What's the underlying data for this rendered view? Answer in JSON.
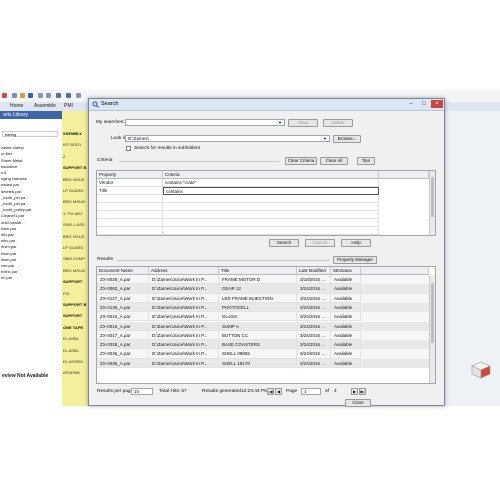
{
  "background_app": {
    "tabs": [
      "Home",
      "Assemble",
      "PMI"
    ],
    "library_title": "arts Library",
    "library_search": "earing",
    "library_items": [
      "",
      "caster clamp",
      "ur liter",
      "Sheet Metal",
      "nsulation",
      "s 8",
      "nging Harness",
      "eaded.par",
      "deleted.par",
      "_tooth_pin.pa...",
      "_tooth_pin.pa...",
      "_tooth_pulley.par",
      "Cleaner1.par",
      "orsCrossMi...",
      "lvsm.par",
      "dkv.par",
      "elbc.par",
      "mvm.par",
      "elsm.par",
      "lbsm.par",
      "cmr.par",
      "ectric.par",
      "nn.par"
    ],
    "library_selected_index": 0,
    "preview_text": "eview Not Available",
    "yellow_column": [
      "SSEMBLY",
      "KIT BODY",
      "2",
      "SUPPORT B",
      "BRG HOUS",
      "LP GUARD",
      "BRG MOUN",
      "1: FIX ADJ",
      "SHELL ASS",
      "BRG HOUS",
      "LP GUARD",
      "SBM COMP",
      "BRG MOUN",
      "SUPPORT",
      "FIX",
      "SUPPORT B",
      "SUPPORT",
      "ONE TAPE",
      "EL ASBL",
      "EL ASBL",
      "EL ASSEM",
      "ASSEMB"
    ]
  },
  "dialog": {
    "title": "Search",
    "my_searches_label": "My searches:",
    "my_searches_value": "",
    "save_label": "Save",
    "delete_label": "Delete",
    "look_in_label": "Look in:",
    "look_in_value": "D:\\Zames\\",
    "browse_label": "Browse...",
    "subfolders_label": "Search for results in subfolders",
    "criteria_section_label": "Criteria",
    "clear_criteria_label": "Clear Criteria",
    "clear_all_label": "Clear All",
    "tips_label": "Tips",
    "criteria_headers": [
      "Property",
      "Criteria"
    ],
    "criteria_rows": [
      [
        "Vendor",
        "contains \"crate\""
      ],
      [
        "Title",
        "contains"
      ],
      [
        "",
        ""
      ],
      [
        "",
        ""
      ],
      [
        "",
        ""
      ],
      [
        "",
        ""
      ],
      [
        "",
        ""
      ]
    ],
    "search_label": "Search",
    "cancel_label": "Cancel",
    "help_label": "Help",
    "results_section_label": "Results",
    "property_manager_label": "Property Manager",
    "results_headers": [
      "Document Name",
      "Address",
      "Title",
      "Last Modified",
      "SEStatus"
    ],
    "results_rows": [
      [
        "ZX-0030_A.par",
        "D:\\Zames\\Juice\\Work In P...",
        "FRAME MOTOR D",
        "3/18/2016 ...",
        "Available"
      ],
      [
        "ZX-0083_A.par",
        "D:\\Zames\\Juice\\Work In P...",
        "GEAR 12",
        "3/24/2016 ...",
        "Available"
      ],
      [
        "ZX-0127_A.par",
        "D:\\Zames\\Juice\\Work In P...",
        "LED FRAME INJECTION",
        "3/24/2016 ...",
        "Available"
      ],
      [
        "ZX-0135_A.par",
        "D:\\Zames\\Juice\\Work In P...",
        "PHOTOCELL",
        "3/24/2016 ...",
        "Available"
      ],
      [
        "ZX-0016_A.par",
        "D:\\Zames\\Juice\\Work In P...",
        "GLASS",
        "3/24/2016 ...",
        "Available"
      ],
      [
        "ZX-0016_A.par",
        "D:\\Zames\\Juice\\Work In P...",
        "SUMP A",
        "3/24/2016 ...",
        "Available"
      ],
      [
        "ZX-0017_A.par",
        "D:\\Zames\\Juice\\Work In P...",
        "BUTTON CC",
        "3/24/2016 ...",
        "Available"
      ],
      [
        "ZX-0028_A.par",
        "D:\\Zames\\Juice\\Work In P...",
        "BASE COASTERS",
        "3/24/2016 ...",
        "Available"
      ],
      [
        "ZX-0036_A.par",
        "D:\\Zames\\Juice\\Work In P...",
        "SHELL 08055",
        "3/24/2016 ...",
        "Available"
      ],
      [
        "ZX-0036_A.par",
        "D:\\Zames\\Juice\\Work In P...",
        "SHELL 18170",
        "3/24/2016 ...",
        "Available"
      ]
    ],
    "results_per_page_label": "Results per page:",
    "results_per_page_value": "15",
    "total_hits_label": "Total Hits: 57",
    "results_generated_label": "Results generated",
    "results_generated_time": "12:24:44 PM",
    "page_label": "Page",
    "page_value": "1",
    "page_of": "of",
    "page_total": "4",
    "close_label": "Close"
  },
  "colors": {
    "library_header": "#3c66a8",
    "yellow_column": "#f3ef9a",
    "selected_row": "#cfe3f8",
    "results_row_alt": "#e8e8e8"
  }
}
